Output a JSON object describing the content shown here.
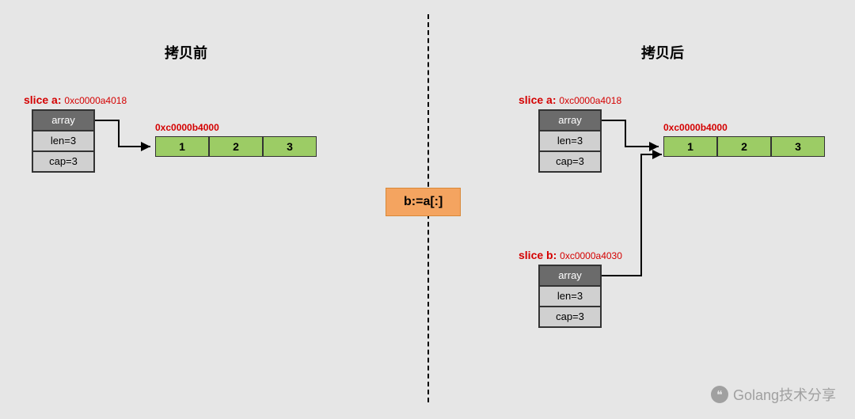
{
  "left": {
    "title": "拷贝前",
    "slice_a": {
      "label": "slice a",
      "addr": "0xc0000a4018",
      "array": "array",
      "len": "len=3",
      "cap": "cap=3"
    },
    "array_addr": "0xc0000b4000",
    "array_values": [
      "1",
      "2",
      "3"
    ]
  },
  "right": {
    "title": "拷贝后",
    "slice_a": {
      "label": "slice a",
      "addr": "0xc0000a4018",
      "array": "array",
      "len": "len=3",
      "cap": "cap=3"
    },
    "slice_b": {
      "label": "slice b",
      "addr": "0xc0000a4030",
      "array": "array",
      "len": "len=3",
      "cap": "cap=3"
    },
    "array_addr": "0xc0000b4000",
    "array_values": [
      "1",
      "2",
      "3"
    ]
  },
  "code": "b:=a[:]",
  "watermark": "Golang技术分享"
}
